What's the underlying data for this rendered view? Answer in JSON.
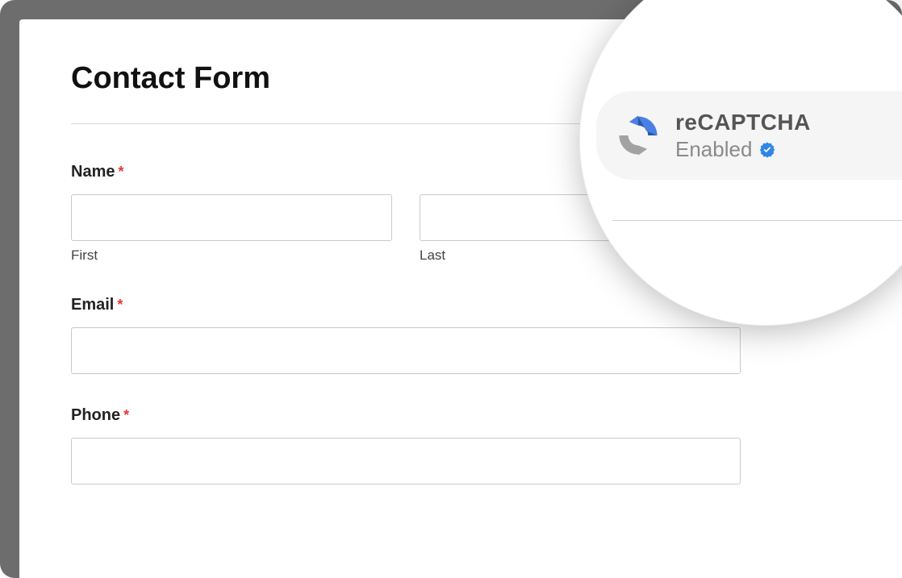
{
  "page": {
    "title": "Contact Form"
  },
  "fields": {
    "name": {
      "label": "Name",
      "required_marker": "*",
      "first_sublabel": "First",
      "last_sublabel": "Last"
    },
    "email": {
      "label": "Email",
      "required_marker": "*"
    },
    "phone": {
      "label": "Phone",
      "required_marker": "*"
    }
  },
  "recaptcha": {
    "title": "reCAPTCHA",
    "status": "Enabled"
  },
  "colors": {
    "recaptcha_blue": "#4a80e4",
    "recaptcha_dark_blue": "#29539b",
    "recaptcha_gray": "#a2a2a2",
    "verified_blue": "#2f86e8",
    "required_red": "#e03b3b"
  }
}
